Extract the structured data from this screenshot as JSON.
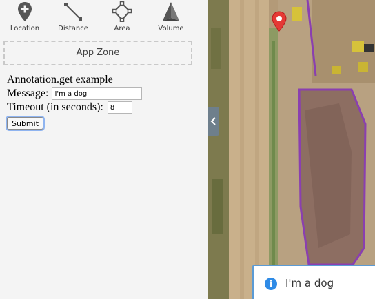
{
  "toolbar": {
    "tools": [
      {
        "label": "Location",
        "icon": "location-pin-plus-icon"
      },
      {
        "label": "Distance",
        "icon": "distance-line-icon"
      },
      {
        "label": "Area",
        "icon": "area-polygon-icon"
      },
      {
        "label": "Volume",
        "icon": "volume-cone-icon"
      }
    ]
  },
  "app_zone": {
    "label": "App Zone"
  },
  "form": {
    "title": "Annotation.get example",
    "message_label": "Message:",
    "message_value": "I'm a dog",
    "timeout_label": "Timeout (in seconds):",
    "timeout_value": "8",
    "submit_label": "Submit"
  },
  "map": {
    "annotation_color": "#8a3fb0",
    "pin_color": "#e53935",
    "collapse_icon": "chevron-left-icon"
  },
  "toast": {
    "icon": "info-icon",
    "text": "I'm a dog",
    "accent": "#2f8be6"
  }
}
